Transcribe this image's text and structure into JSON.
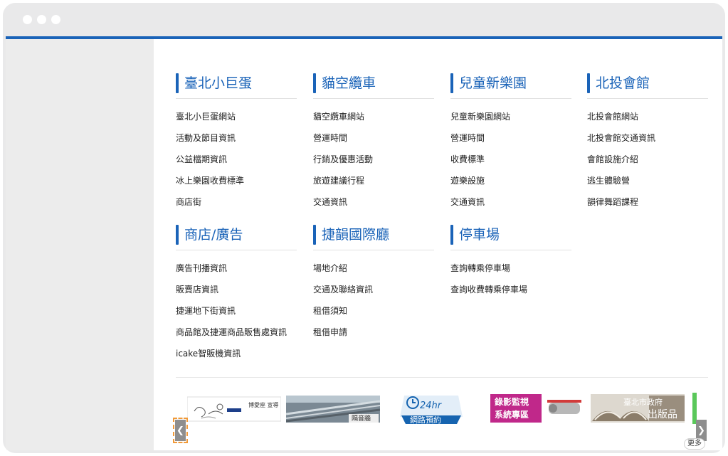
{
  "sections": [
    {
      "title": "臺北小巨蛋",
      "links": [
        "臺北小巨蛋網站",
        "活動及節目資訊",
        "公益檔期資訊",
        "冰上樂園收費標準",
        "商店街"
      ]
    },
    {
      "title": "貓空纜車",
      "links": [
        "貓空纜車網站",
        "營運時間",
        "行銷及優惠活動",
        "旅遊建議行程",
        "交通資訊"
      ]
    },
    {
      "title": "兒童新樂園",
      "links": [
        "兒童新樂園網站",
        "營運時間",
        "收費標準",
        "遊樂設施",
        "交通資訊"
      ]
    },
    {
      "title": "北投會館",
      "links": [
        "北投會館網站",
        "北投會館交通資訊",
        "會館設施介紹",
        "逃生體驗營",
        "韻律舞蹈課程"
      ]
    },
    {
      "title": "商店/廣告",
      "links": [
        "廣告刊播資訊",
        "販賣店資訊",
        "捷運地下街資訊",
        "商品館及捷運商品販售處資訊",
        "icake智販機資訊"
      ]
    },
    {
      "title": "捷韻國際廳",
      "links": [
        "場地介紹",
        "交通及聯絡資訊",
        "租借須知",
        "租借申請"
      ]
    },
    {
      "title": "停車場",
      "links": [
        "查詢轉乘停車場",
        "查詢收費轉乘停車場"
      ]
    }
  ],
  "banners": [
    {
      "text": "博愛座 宣導",
      "icon": "priority-seat-illustration"
    },
    {
      "text": "隔音牆",
      "icon": "sound-barrier-photo"
    },
    {
      "text_top": "24hr",
      "text_bottom": "網路預約",
      "icon": "clock-badge"
    },
    {
      "text_top": "錄影監視",
      "text_bottom": "系統專區",
      "icon": "cctv-camera"
    },
    {
      "text_top": "臺北市政府",
      "text_bottom": "出版品",
      "icon": "open-book"
    }
  ],
  "carousel": {
    "prev_icon": "chevron-left-icon",
    "next_icon": "chevron-right-icon",
    "more_label": "更多"
  },
  "colors": {
    "accent": "#1a63b8",
    "text": "#222222",
    "sidebar": "#ececec",
    "frame": "#e9e9ea"
  }
}
